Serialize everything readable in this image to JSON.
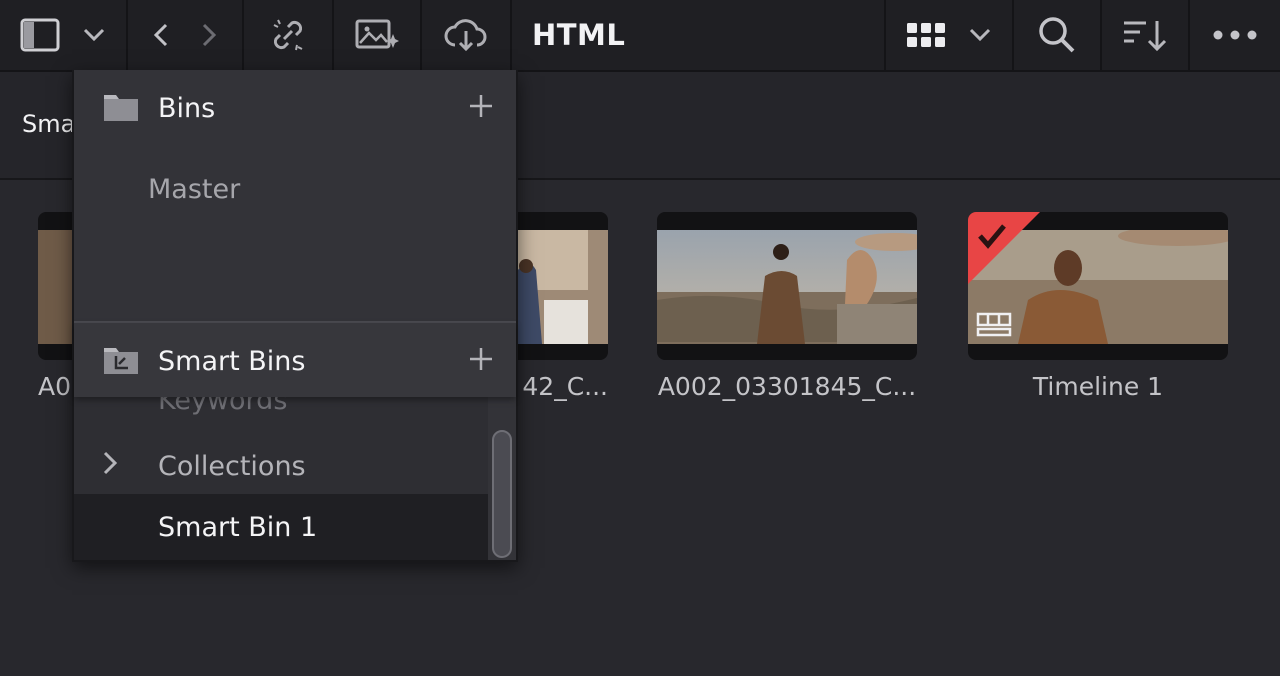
{
  "toolbar": {
    "title": "HTML",
    "icons": [
      "sidebar-toggle-icon",
      "chevron-down-icon",
      "back-icon",
      "forward-icon",
      "unlink-icon",
      "image-sparkle-icon",
      "cloud-download-icon",
      "grid-view-icon",
      "chevron-down-icon",
      "search-icon",
      "sort-icon",
      "more-icon"
    ]
  },
  "subbar": {
    "label": "Sma"
  },
  "clips": [
    {
      "label": "A0"
    },
    {
      "label": "42_C..."
    },
    {
      "label": "A002_03301845_C..."
    },
    {
      "label": "Timeline 1"
    }
  ],
  "panel": {
    "bins": {
      "title": "Bins",
      "items": [
        "Master"
      ]
    },
    "smart_bins": {
      "title": "Smart Bins",
      "items": [
        {
          "label": "Keywords",
          "expandable": false,
          "selected": false
        },
        {
          "label": "Collections",
          "expandable": true,
          "selected": false
        },
        {
          "label": "Smart Bin 1",
          "expandable": false,
          "selected": true
        }
      ]
    }
  },
  "colors": {
    "background": "#28282d",
    "toolbar": "#1f1f23",
    "panel": "#333338",
    "selected_row": "#1f1f23",
    "timeline_flag": "#e84545"
  }
}
